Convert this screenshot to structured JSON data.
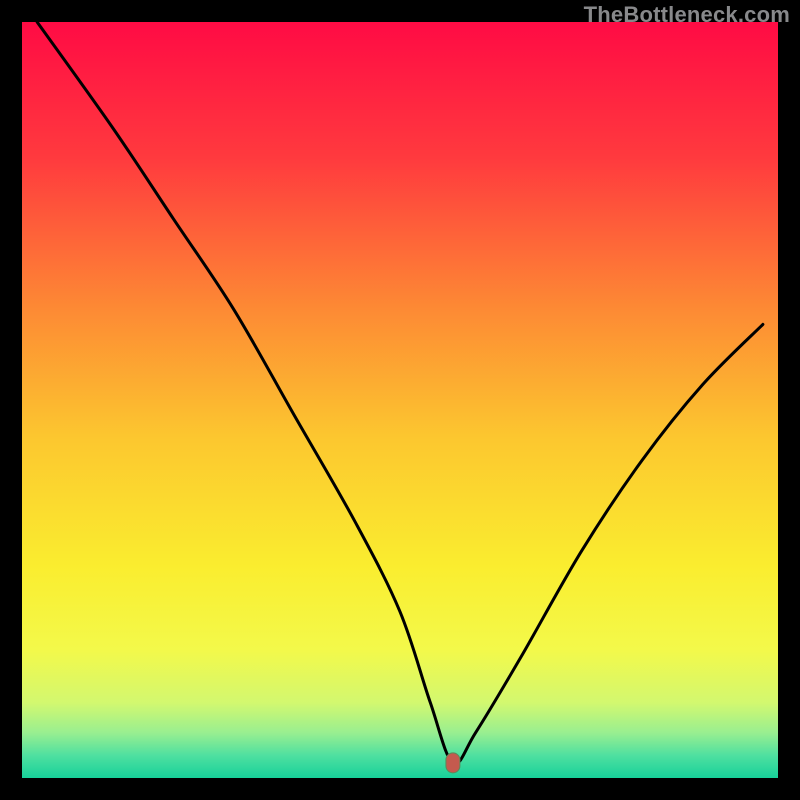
{
  "watermark": "TheBottleneck.com",
  "chart_data": {
    "type": "line",
    "title": "",
    "xlabel": "",
    "ylabel": "",
    "xlim": [
      0,
      100
    ],
    "ylim": [
      0,
      100
    ],
    "grid": false,
    "legend": false,
    "annotations": [
      {
        "label": "minimum-marker",
        "x": 57,
        "y": 2
      }
    ],
    "series": [
      {
        "name": "bottleneck-curve",
        "color": "#000000",
        "x": [
          2,
          12,
          20,
          28,
          36,
          44,
          50,
          54,
          57,
          60,
          66,
          74,
          82,
          90,
          98
        ],
        "values": [
          100,
          86,
          74,
          62,
          48,
          34,
          22,
          10,
          2,
          6,
          16,
          30,
          42,
          52,
          60
        ]
      }
    ],
    "background_gradient": {
      "stops": [
        {
          "offset": 0.0,
          "color": "#ff0b44"
        },
        {
          "offset": 0.18,
          "color": "#ff3a3e"
        },
        {
          "offset": 0.38,
          "color": "#fd8a34"
        },
        {
          "offset": 0.55,
          "color": "#fcc72f"
        },
        {
          "offset": 0.72,
          "color": "#faed2f"
        },
        {
          "offset": 0.83,
          "color": "#f3f94a"
        },
        {
          "offset": 0.9,
          "color": "#d3f86f"
        },
        {
          "offset": 0.94,
          "color": "#99ef90"
        },
        {
          "offset": 0.97,
          "color": "#4fe0a0"
        },
        {
          "offset": 1.0,
          "color": "#17d19a"
        }
      ]
    }
  },
  "colors": {
    "frame": "#000000",
    "curve": "#000000",
    "marker_fill": "#c45a4e",
    "marker_stroke": "#5a8a5a"
  }
}
